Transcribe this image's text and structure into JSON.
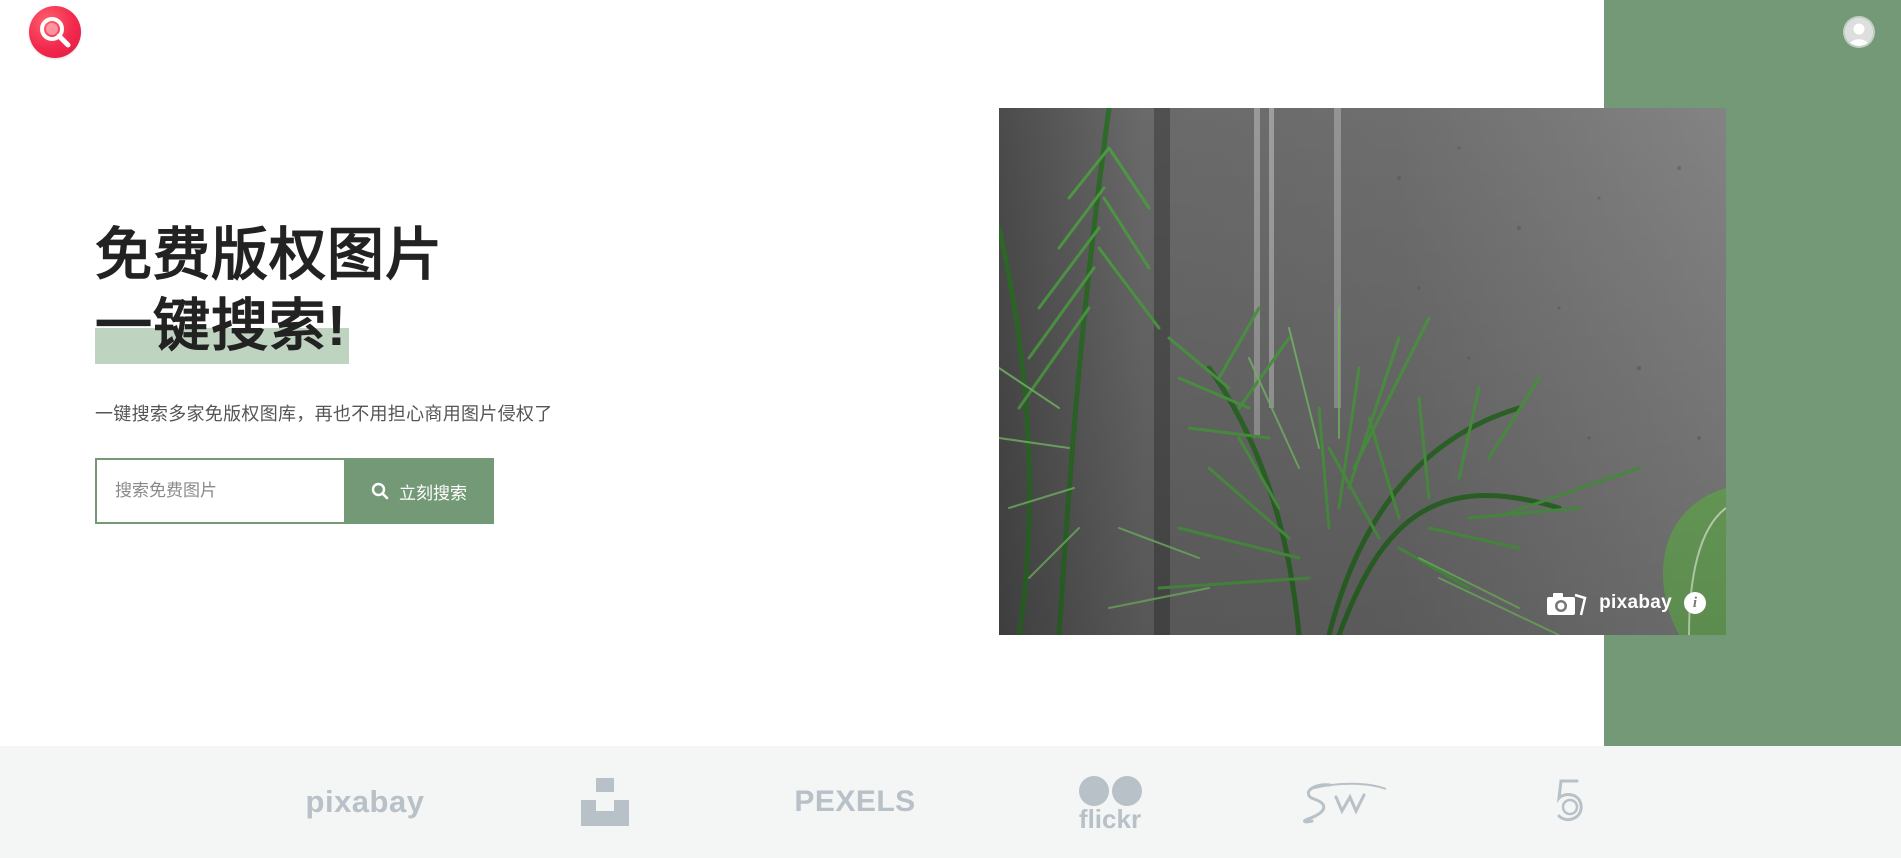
{
  "header": {
    "logo_icon": "magnifier-icon",
    "avatar_icon": "user-avatar-icon"
  },
  "hero": {
    "headline_line1": "免费版权图片",
    "headline_line2": "一键搜索!",
    "subtitle": "一键搜索多家免版权图库，再也不用担心商用图片侵权了"
  },
  "search": {
    "placeholder": "搜索免费图片",
    "value": "",
    "button_label": "立刻搜索",
    "button_icon": "search-icon"
  },
  "photo_credit": {
    "brand": "pixabay",
    "camera_icon": "camera-icon",
    "info_icon": "info-icon",
    "info_glyph": "i"
  },
  "sources": [
    {
      "name": "pixabay",
      "icon": "pixabay-logo"
    },
    {
      "name": "unsplash",
      "icon": "unsplash-logo"
    },
    {
      "name": "PEXELS",
      "icon": "pexels-logo"
    },
    {
      "name": "flickr",
      "icon": "flickr-logo"
    },
    {
      "name": "Stockwire",
      "icon": "stocksnap-logo"
    },
    {
      "name": "500px",
      "icon": "500px-logo"
    }
  ],
  "colors": {
    "accent_green": "#739977",
    "highlight": "#bfd3c1",
    "logo_red": "#f2284d",
    "strip_bg": "#f4f5f5",
    "logo_gray": "#b7c1c7"
  }
}
